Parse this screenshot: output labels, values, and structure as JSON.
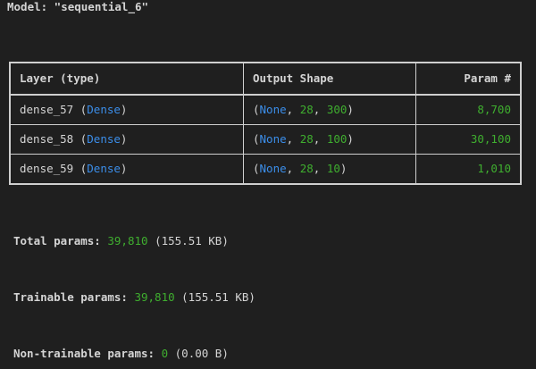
{
  "model": {
    "title": "Model: \"sequential_6\""
  },
  "table": {
    "headers": [
      "Layer (type)",
      "Output Shape",
      "Param #"
    ],
    "rows": [
      {
        "name": "dense_57",
        "type": "Dense",
        "shape": [
          "None",
          "28",
          "300"
        ],
        "params": "8,700"
      },
      {
        "name": "dense_58",
        "type": "Dense",
        "shape": [
          "None",
          "28",
          "100"
        ],
        "params": "30,100"
      },
      {
        "name": "dense_59",
        "type": "Dense",
        "shape": [
          "None",
          "28",
          "10"
        ],
        "params": "1,010"
      }
    ]
  },
  "summary": {
    "total_label": "Total params:",
    "total_value": "39,810",
    "total_size": "(155.51 KB)",
    "trainable_label": "Trainable params:",
    "trainable_value": "39,810",
    "trainable_size": "(155.51 KB)",
    "non_trainable_label": "Non-trainable params:",
    "non_trainable_value": "0",
    "non_trainable_size": "(0.00 B)"
  },
  "colors": {
    "background": "#1f1f1f",
    "text": "#d4d4d4",
    "type_blue": "#3b8eea",
    "none_cyan": "#11a8cd",
    "number_green": "#3fae2f"
  }
}
